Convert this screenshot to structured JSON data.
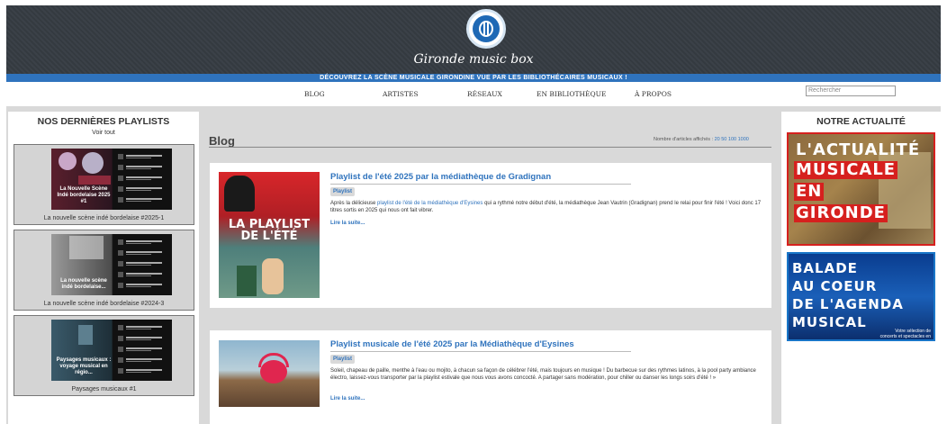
{
  "site": {
    "logo_text": "Gironde music box",
    "banner": "DÉCOUVREZ LA SCÈNE MUSICALE GIRONDINE VUE PAR LES BIBLIOTHÉCAIRES MUSICAUX !"
  },
  "nav": {
    "items": [
      {
        "label": "BLOG"
      },
      {
        "label": "ARTISTES"
      },
      {
        "label": "RÉSEAUX"
      },
      {
        "label": "EN BIBLIOTHÈQUE"
      },
      {
        "label": "À PROPOS"
      }
    ],
    "search_placeholder": "Rechercher"
  },
  "sidebar_left": {
    "title": "NOS DERNIÈRES PLAYLISTS",
    "see_all": "Voir tout",
    "playlists": [
      {
        "label": "La nouvelle scène indé bordelaise #2025-1",
        "thumb_title": "La Nouvelle Scène Indé bordelaise 2025 #1"
      },
      {
        "label": "La nouvelle scène indé bordelaise #2024-3",
        "thumb_title": "La nouvelle scène indé bordelaise..."
      },
      {
        "label": "Paysages musicaux #1",
        "thumb_title": "Paysages musicaux : voyage musical en régio..."
      }
    ]
  },
  "blog": {
    "title": "Blog",
    "count_label": "Nombre d'articles affichés :",
    "count_options": "20 50 100 1000",
    "articles": [
      {
        "title": "Playlist de l'été 2025 par la médiathèque de Gradignan",
        "tag": "Playlist",
        "text_before": "Après la délicieuse ",
        "text_link": "playlist de l'été de la médiathèque d'Eysines",
        "text_after": " qui a rythmé notre début d'été, la médiathèque Jean Vautrin (Gradignan) prend le relai pour finir l'été ! Voici donc 17 titres sortis en 2025 qui nous ont fait vibrer.",
        "more": "Lire la suite...",
        "image_caption": "LA PLAYLIST DE L'ÉTÉ"
      },
      {
        "title": "Playlist musicale de l'été 2025 par la Médiathèque d'Eysines",
        "tag": "Playlist",
        "text": "Soleil, chapeau de paille, menthe à l'eau ou mojito, à chacun sa façon de célébrer l'été, mais toujours en musique ! Du barbecue sur des rythmes latinos, à la pool party ambiance électro, laissez-vous transporter par la playlist estivale que nous vous avons concocté. A partager sans modération, pour chiller ou danser les longs soirs d'été ! »",
        "more": "Lire la suite..."
      }
    ]
  },
  "sidebar_right": {
    "title": "NOTRE ACTUALITÉ",
    "news1_lines": [
      "L'ACTUALITÉ",
      "MUSICALE",
      "EN",
      "GIRONDE"
    ],
    "news2_lines": [
      "BALADE",
      "AU COEUR",
      "DE L'AGENDA",
      "MUSICAL"
    ],
    "news2_small": "Votre sélection de concerts et spectacles en Gironde"
  },
  "colors": {
    "accent": "#2f73bd",
    "header_bg": "#343a40",
    "news_red": "#d6201e"
  }
}
